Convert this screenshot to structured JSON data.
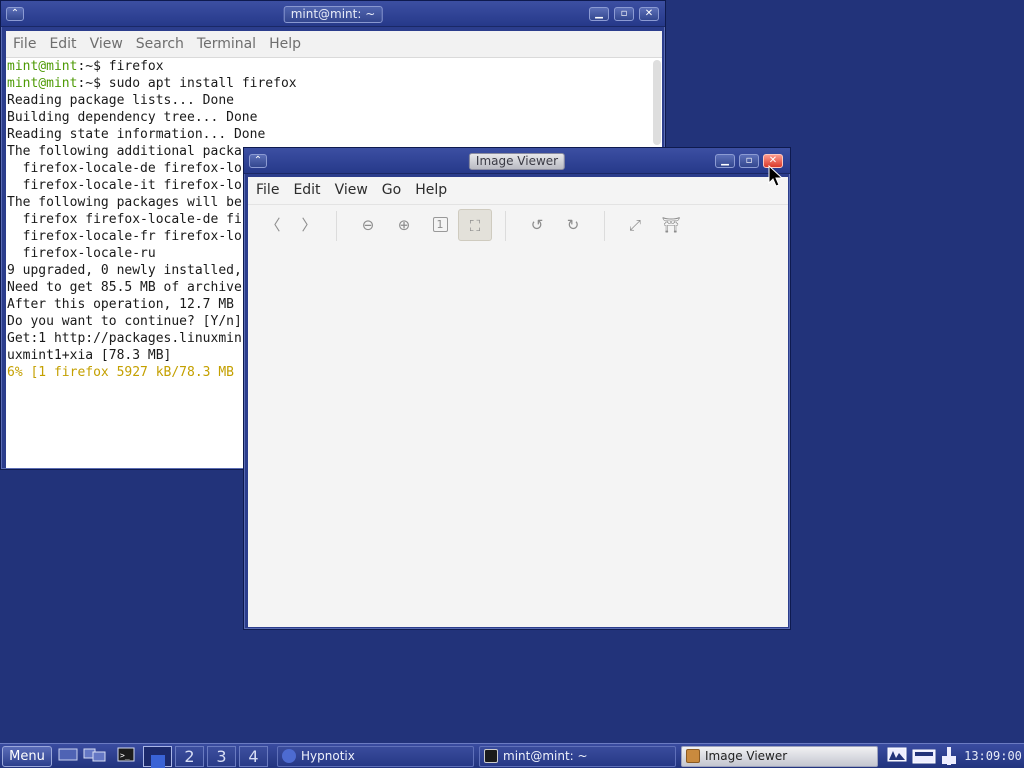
{
  "terminal": {
    "title": "mint@mint: ~",
    "menu": [
      "File",
      "Edit",
      "View",
      "Search",
      "Terminal",
      "Help"
    ],
    "prompt_user": "mint@mint",
    "prompt_path": ":~$ ",
    "lines": [
      {
        "kind": "prompt",
        "command": "firefox"
      },
      {
        "kind": "prompt",
        "command": "sudo apt install firefox"
      },
      {
        "kind": "out",
        "text": "Reading package lists... Done"
      },
      {
        "kind": "out",
        "text": "Building dependency tree... Done"
      },
      {
        "kind": "out",
        "text": "Reading state information... Done"
      },
      {
        "kind": "out",
        "text": "The following additional packa"
      },
      {
        "kind": "out",
        "text": "  firefox-locale-de firefox-lo"
      },
      {
        "kind": "out",
        "text": "  firefox-locale-it firefox-lo"
      },
      {
        "kind": "out",
        "text": "The following packages will be"
      },
      {
        "kind": "out",
        "text": "  firefox firefox-locale-de fi"
      },
      {
        "kind": "out",
        "text": "  firefox-locale-fr firefox-lo"
      },
      {
        "kind": "out",
        "text": "  firefox-locale-ru"
      },
      {
        "kind": "out",
        "text": "9 upgraded, 0 newly installed,"
      },
      {
        "kind": "out",
        "text": "Need to get 85.5 MB of archive"
      },
      {
        "kind": "out",
        "text": "After this operation, 12.7 MB"
      },
      {
        "kind": "out",
        "text": "Do you want to continue? [Y/n]"
      },
      {
        "kind": "out",
        "text": "Get:1 http://packages.linuxmin"
      },
      {
        "kind": "out",
        "text": "uxmint1+xia [78.3 MB]"
      },
      {
        "kind": "progress",
        "text": "6% [1 firefox 5927 kB/78.3 MB"
      }
    ]
  },
  "viewer": {
    "title": "Image Viewer",
    "menu": [
      "File",
      "Edit",
      "View",
      "Go",
      "Help"
    ],
    "tools": [
      {
        "name": "previous-icon",
        "glyph": "〈"
      },
      {
        "name": "next-icon",
        "glyph": "〉"
      },
      {
        "name": "zoom-out-icon",
        "glyph": "⊖"
      },
      {
        "name": "zoom-in-icon",
        "glyph": "⊕"
      },
      {
        "name": "zoom-normal-icon",
        "glyph": "1"
      },
      {
        "name": "zoom-fit-icon",
        "glyph": "⛶"
      },
      {
        "name": "rotate-left-icon",
        "glyph": "↺"
      },
      {
        "name": "rotate-right-icon",
        "glyph": "↻"
      },
      {
        "name": "fullscreen-icon",
        "glyph": "⤢"
      },
      {
        "name": "slideshow-icon",
        "glyph": "⛩"
      }
    ]
  },
  "taskbar": {
    "menu_label": "Menu",
    "workspaces": [
      "1",
      "2",
      "3",
      "4"
    ],
    "current_workspace": "1",
    "tasks": [
      {
        "label": "Hypnotix",
        "icon": "hypnotix-icon",
        "active": false
      },
      {
        "label": "mint@mint: ~",
        "icon": "terminal-icon",
        "active": false
      },
      {
        "label": "Image Viewer",
        "icon": "image-viewer-icon",
        "active": true
      }
    ],
    "clock": "13:09:00"
  },
  "colors": {
    "desktop": "#22337a",
    "prompt_user": "#4e9a06",
    "progress": "#c4a000"
  }
}
